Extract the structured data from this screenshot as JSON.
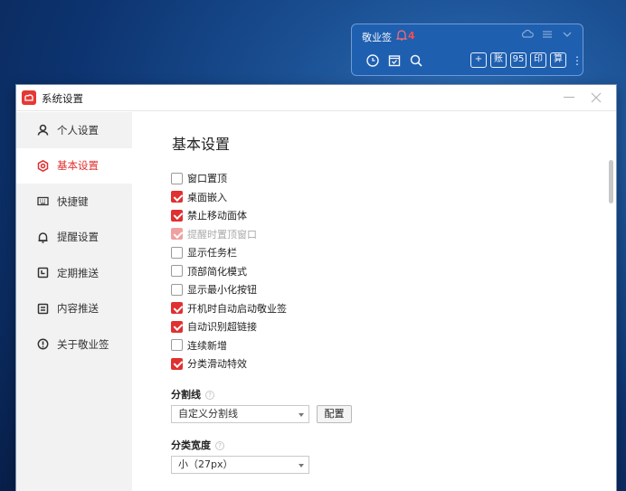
{
  "widget": {
    "title": "敬业签",
    "reminder_count": "4",
    "buttons": [
      "+",
      "账",
      "95",
      "印",
      "算"
    ]
  },
  "window": {
    "title": "系统设置"
  },
  "sidebar": {
    "items": [
      {
        "label": "个人设置",
        "icon": "user-icon"
      },
      {
        "label": "基本设置",
        "icon": "gear-icon"
      },
      {
        "label": "快捷键",
        "icon": "keyboard-icon"
      },
      {
        "label": "提醒设置",
        "icon": "bell-icon"
      },
      {
        "label": "定期推送",
        "icon": "schedule-icon"
      },
      {
        "label": "内容推送",
        "icon": "document-icon"
      },
      {
        "label": "关于敬业签",
        "icon": "info-icon"
      }
    ],
    "active_index": 1
  },
  "main": {
    "title": "基本设置",
    "options": [
      {
        "label": "窗口置顶",
        "checked": false,
        "disabled": false
      },
      {
        "label": "桌面嵌入",
        "checked": true,
        "disabled": false
      },
      {
        "label": "禁止移动面体",
        "checked": true,
        "disabled": false
      },
      {
        "label": "提醒时置顶窗口",
        "checked": true,
        "disabled": true
      },
      {
        "label": "显示任务栏",
        "checked": false,
        "disabled": false
      },
      {
        "label": "顶部简化模式",
        "checked": false,
        "disabled": false
      },
      {
        "label": "显示最小化按钮",
        "checked": false,
        "disabled": false
      },
      {
        "label": "开机时自动启动敬业签",
        "checked": true,
        "disabled": false
      },
      {
        "label": "自动识别超链接",
        "checked": true,
        "disabled": false
      },
      {
        "label": "连续新增",
        "checked": false,
        "disabled": false
      },
      {
        "label": "分类滑动特效",
        "checked": true,
        "disabled": false
      }
    ],
    "divider_label": "分割线",
    "divider_value": "自定义分割线",
    "config_button": "配置",
    "width_label": "分类宽度",
    "width_value": "小（27px）"
  },
  "colors": {
    "accent": "#e03030",
    "widget_bg": "#1f5fb0"
  }
}
